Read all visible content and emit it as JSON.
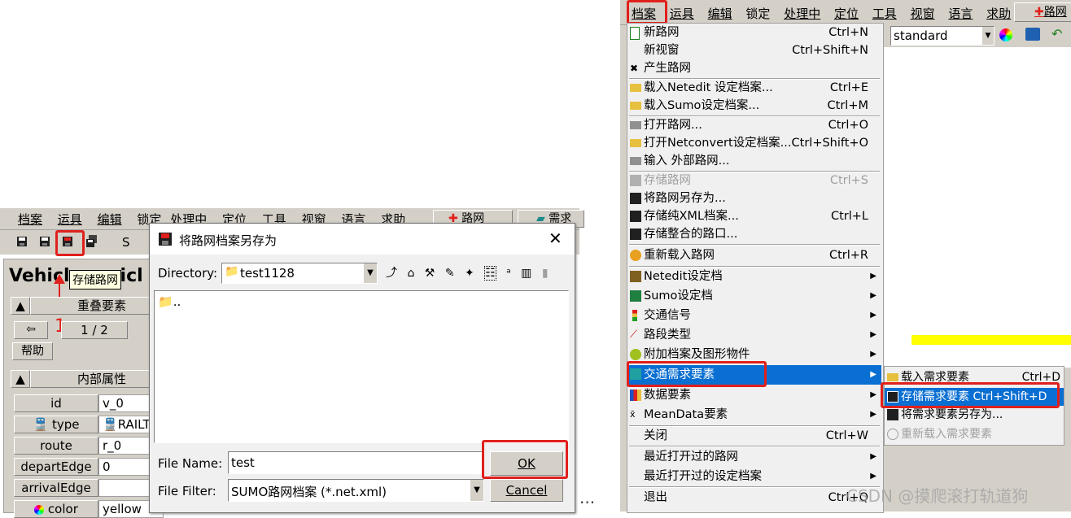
{
  "left_window": {
    "menubar": [
      "档案",
      "运具",
      "编辑",
      "锁定",
      "处理中",
      "定位",
      "工具",
      "视窗",
      "语言",
      "求助"
    ],
    "mode_buttons": [
      "路网",
      "需求"
    ],
    "toolbar_s": "S",
    "tooltip": "存储路网",
    "annotation_number": "1",
    "panel_title_a": "Vehicl",
    "panel_title_b": "icl",
    "overlap_header": "重叠要素",
    "nav_page": "1 / 2",
    "help_button": "帮助",
    "inner_header": "内部属性",
    "attributes": [
      {
        "name": "id",
        "value": "v_0"
      },
      {
        "name": "type",
        "value": "RAILT"
      },
      {
        "name": "route",
        "value": "r_0"
      },
      {
        "name": "departEdge",
        "value": "0"
      },
      {
        "name": "arrivalEdge",
        "value": ""
      },
      {
        "name": "color",
        "value": "yellow"
      }
    ]
  },
  "dialog": {
    "title": "将路网档案另存为",
    "directory_label": "Directory:",
    "directory_value": "test1128",
    "list_items": [
      ".."
    ],
    "file_name_label": "File Name:",
    "file_name_value": "test",
    "file_filter_label": "File Filter:",
    "file_filter_value": "SUMO路网档案 (*.net.xml)",
    "ok_label": "OK",
    "cancel_label": "Cancel",
    "ellipsis": "..."
  },
  "right_window": {
    "menubar": [
      "档案",
      "运具",
      "编辑",
      "锁定",
      "处理中",
      "定位",
      "工具",
      "视窗",
      "语言",
      "求助"
    ],
    "mode_button": "路网",
    "scheme_value": "standard",
    "file_menu": [
      {
        "label": "新路网",
        "shortcut": "Ctrl+N"
      },
      {
        "label": "新视窗",
        "shortcut": "Ctrl+Shift+N"
      },
      {
        "label": "产生路网",
        "shortcut": ""
      },
      {
        "label": "载入Netedit 设定档案...",
        "shortcut": "Ctrl+E"
      },
      {
        "label": "载入Sumo设定档案...",
        "shortcut": "Ctrl+M"
      },
      {
        "label": "打开路网...",
        "shortcut": "Ctrl+O"
      },
      {
        "label": "打开Netconvert设定档案...",
        "shortcut": "Ctrl+Shift+O"
      },
      {
        "label": "输入 外部路网...",
        "shortcut": ""
      },
      {
        "label": "存储路网",
        "shortcut": "Ctrl+S"
      },
      {
        "label": "将路网另存为...",
        "shortcut": ""
      },
      {
        "label": "存储纯XML档案...",
        "shortcut": "Ctrl+L"
      },
      {
        "label": "存储整合的路口...",
        "shortcut": ""
      },
      {
        "label": "重新载入路网",
        "shortcut": "Ctrl+R"
      },
      {
        "label": "Netedit设定档",
        "shortcut": ""
      },
      {
        "label": "Sumo设定档",
        "shortcut": ""
      },
      {
        "label": "交通信号",
        "shortcut": ""
      },
      {
        "label": "路段类型",
        "shortcut": ""
      },
      {
        "label": "附加档案及图形物件",
        "shortcut": ""
      },
      {
        "label": "交通需求要素",
        "shortcut": ""
      },
      {
        "label": "数据要素",
        "shortcut": ""
      },
      {
        "label": "MeanData要素",
        "shortcut": ""
      },
      {
        "label": "关闭",
        "shortcut": "Ctrl+W"
      },
      {
        "label": "最近打开过的路网",
        "shortcut": ""
      },
      {
        "label": "最近打开过的设定档案",
        "shortcut": ""
      },
      {
        "label": "退出",
        "shortcut": "Ctrl+Q"
      }
    ],
    "submenu": [
      {
        "label": "载入需求要素",
        "shortcut": "Ctrl+D"
      },
      {
        "label": "存储需求要素 Ctrl+Shift+D",
        "shortcut": ""
      },
      {
        "label": "将需求要素另存为...",
        "shortcut": ""
      },
      {
        "label": "重新载入需求要素",
        "shortcut": ""
      }
    ]
  },
  "watermark": "CSDN @摸爬滚打轨道狗",
  "colors": {
    "highlight": "#0a6fd2",
    "annotation_red": "#e0201c",
    "panel": "#d4d0c8"
  }
}
